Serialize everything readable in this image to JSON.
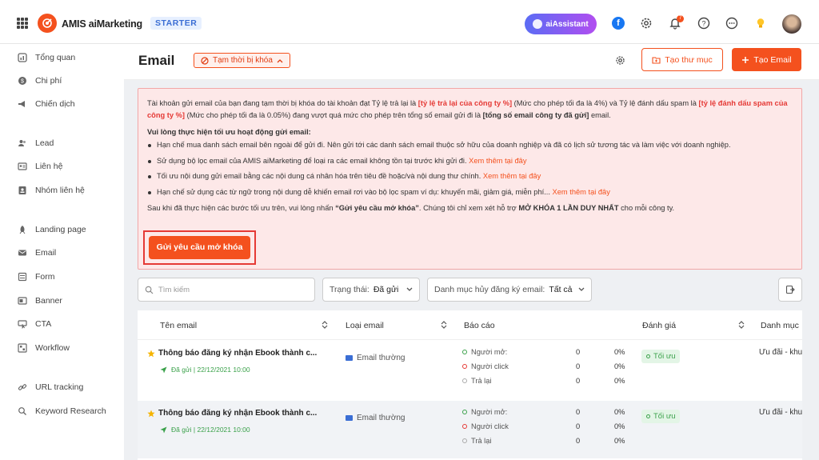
{
  "topbar": {
    "brand": "AMIS aiMarketing",
    "plan": "STARTER",
    "ai_assistant": "aiAssistant",
    "notification_count": "7",
    "accent": "#f4511e"
  },
  "sidebar": {
    "items": [
      {
        "label": "Tổng quan",
        "icon": "dashboard-icon"
      },
      {
        "label": "Chi phí",
        "icon": "cost-icon"
      },
      {
        "label": "Chiến dịch",
        "icon": "megaphone-icon"
      },
      {
        "label": "Lead",
        "icon": "users-icon"
      },
      {
        "label": "Liên hệ",
        "icon": "contact-card-icon"
      },
      {
        "label": "Nhóm liên hệ",
        "icon": "contact-group-icon"
      },
      {
        "label": "Landing page",
        "icon": "rocket-icon"
      },
      {
        "label": "Email",
        "icon": "mail-icon"
      },
      {
        "label": "Form",
        "icon": "form-icon"
      },
      {
        "label": "Banner",
        "icon": "banner-icon"
      },
      {
        "label": "CTA",
        "icon": "cta-icon"
      },
      {
        "label": "Workflow",
        "icon": "workflow-icon"
      },
      {
        "label": "URL tracking",
        "icon": "link-icon"
      },
      {
        "label": "Keyword Research",
        "icon": "search-icon"
      }
    ]
  },
  "header": {
    "title": "Email",
    "status_tag": "Tạm thời bị khóa",
    "create_folder": "Tạo thư mục",
    "create_email": "Tạo Email"
  },
  "alert": {
    "p1_a": "Tài khoản gửi email của bạn đang tạm thời bị khóa do tài khoản đạt Tỷ lệ trả lại là ",
    "p1_b": "[tỷ lệ trả lại của công ty %]",
    "p1_c": " (Mức cho phép tối đa là 4%) và Tỷ lệ đánh dấu spam là ",
    "p1_d": "[tỷ lệ đánh dấu spam của công ty %]",
    "p1_e": " (Mức cho phép tối đa là 0.05%) đang vượt quá mức cho phép trên tổng số email gửi đi là ",
    "p1_f": "[tổng số email công ty đã gửi]",
    "p1_g": " email.",
    "heading": "Vui lòng thực hiện tối ưu hoạt động gửi email:",
    "bullet1": "Hạn chế mua danh sách email bên ngoài để gửi đi. Nên gửi tới các danh sách email thuộc sở hữu của doanh nghiệp và đã có lịch sử tương tác và làm việc với doanh nghiệp.",
    "bullet2": "Sử dụng bộ lọc email của AMIS aiMarketing để loại ra các email không tồn tại trước khi gửi đi. ",
    "bullet3": "Tối ưu nội dung gửi email bằng các nội dung cá nhân hóa trên tiêu đề hoặc/và nội dung thư chính. ",
    "bullet4": "Hạn chế sử dụng các từ ngữ trong nội dung dễ khiến email rơi vào bộ lọc spam ví dụ: khuyến mãi, giảm giá, miễn phí... ",
    "see_more": "Xem thêm tại đây",
    "p3_a": "Sau khi đã thực hiện các bước tối ưu trên, vui lòng nhấn ",
    "p3_b": "“Gửi yêu cầu mở khóa”",
    "p3_c": ". Chúng tôi chỉ xem xét hỗ trợ ",
    "p3_d": "MỞ KHÓA 1 LẦN DUY NHẤT",
    "p3_e": " cho mỗi công ty.",
    "unlock_button": "Gửi yêu cầu mở khóa"
  },
  "filters": {
    "search_placeholder": "Tìm kiếm",
    "status_label": "Trạng thái:",
    "status_value": "Đã gửi",
    "category_label": "Danh mục hủy đăng ký email:",
    "category_value": "Tất cả"
  },
  "table": {
    "columns": [
      "Tên email",
      "Loại email",
      "Báo cáo",
      "Đánh giá",
      "Danh mục"
    ],
    "report_labels": [
      "Người mở:",
      "Người click",
      "Trả lại"
    ],
    "rows": [
      {
        "title": "Thông báo đăng ký nhận Ebook thành c...",
        "sent": "Đã gửi | 22/12/2021 10:00",
        "type": "Email thường",
        "report_counts": [
          "0",
          "0",
          "0"
        ],
        "report_pcts": [
          "0%",
          "0%",
          "0%"
        ],
        "rating": "Tối ưu",
        "category": "Ưu đãi - khu"
      },
      {
        "title": "Thông báo đăng ký nhận Ebook thành c...",
        "sent": "Đã gửi | 22/12/2021 10:00",
        "type": "Email thường",
        "report_counts": [
          "0",
          "0",
          "0"
        ],
        "report_pcts": [
          "0%",
          "0%",
          "0%"
        ],
        "rating": "Tối ưu",
        "category": "Ưu đãi - khu"
      }
    ]
  }
}
